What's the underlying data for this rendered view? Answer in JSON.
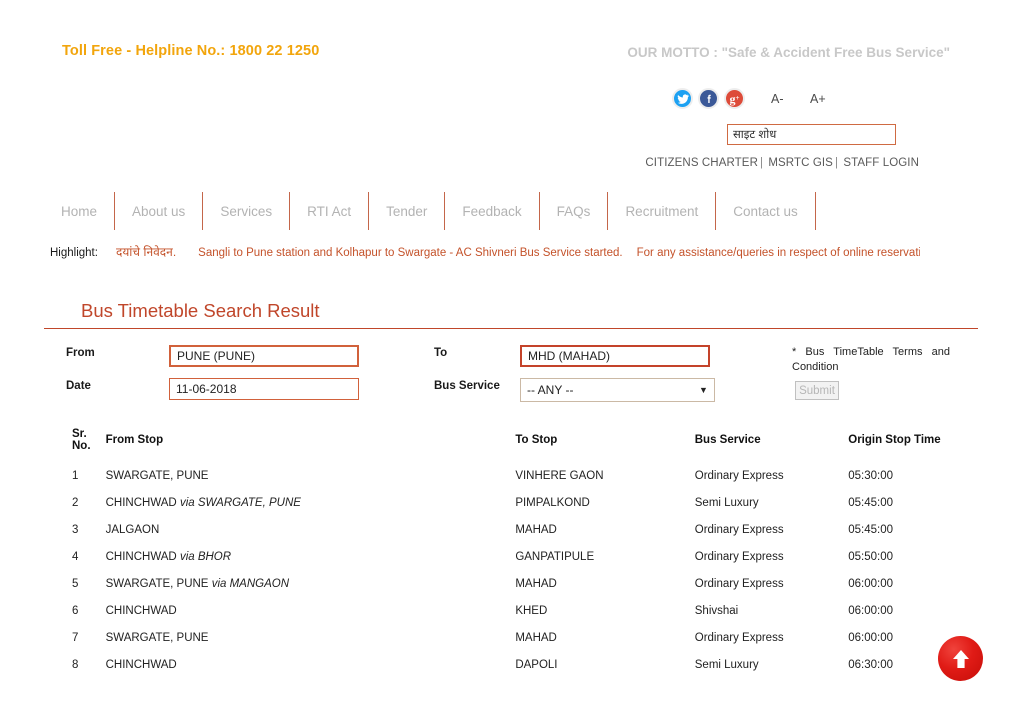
{
  "header": {
    "toll_free": "Toll Free - Helpline No.: 1800 22 1250",
    "motto": "OUR MOTTO : \"Safe & Accident Free Bus Service\"",
    "font_decrease": "A-",
    "font_increase": "A+",
    "social": [
      {
        "name": "twitter-icon",
        "label": "t",
        "color": "#1da1f2"
      },
      {
        "name": "facebook-icon",
        "label": "f",
        "color": "#3b5998"
      },
      {
        "name": "googleplus-icon",
        "label": "g+",
        "color": "#dd4b39"
      }
    ],
    "search": {
      "placeholder": "साइट शोध",
      "value": ""
    },
    "quicklinks": [
      {
        "label": "CITIZENS CHARTER"
      },
      {
        "label": "MSRTC GIS"
      },
      {
        "label": "STAFF LOGIN"
      }
    ],
    "quicklink_separator": "|"
  },
  "nav": {
    "items": [
      {
        "label": "Home",
        "key": "home"
      },
      {
        "label": "About us",
        "key": "about-us"
      },
      {
        "label": "Services",
        "key": "services"
      },
      {
        "label": "RTI Act",
        "key": "rti-act"
      },
      {
        "label": "Tender",
        "key": "tender"
      },
      {
        "label": "Feedback",
        "key": "feedback"
      },
      {
        "label": "FAQs",
        "key": "faqs"
      },
      {
        "label": "Recruitment",
        "key": "recruitment"
      },
      {
        "label": "Contact us",
        "key": "contact-us"
      }
    ]
  },
  "highlight": {
    "label": "Highlight:",
    "marathi": "दयांचे निवेदन.",
    "item1": "Sangli to Pune station and Kolhapur to Swargate - AC Shivneri Bus Service started.",
    "item2": "For any assistance/queries in respect of online reservation"
  },
  "main": {
    "title": "Bus Timetable Search Result",
    "form": {
      "from_label": "From",
      "from_value": "PUNE (PUNE)",
      "date_label": "Date",
      "date_value": "11-06-2018",
      "to_label": "To",
      "to_value": "MHD (MAHAD)",
      "bus_service_label": "Bus Service",
      "bus_service_value": "-- ANY --",
      "bus_service_options": [
        "-- ANY --"
      ],
      "terms_note": "*   Bus   TimeTable   Terms   and Condition",
      "submit_label": "Submit"
    },
    "table": {
      "columns": [
        "Sr. No.",
        "From Stop",
        "To Stop",
        "Bus Service",
        "Origin Stop Time"
      ],
      "rows": [
        {
          "sr": "1",
          "from": "SWARGATE, PUNE",
          "via": "",
          "to": "VINHERE GAON",
          "service": "Ordinary Express",
          "time": "05:30:00"
        },
        {
          "sr": "2",
          "from": "CHINCHWAD",
          "via": "SWARGATE, PUNE",
          "to": "PIMPALKOND",
          "service": "Semi Luxury",
          "time": "05:45:00"
        },
        {
          "sr": "3",
          "from": "JALGAON",
          "via": "",
          "to": "MAHAD",
          "service": "Ordinary Express",
          "time": "05:45:00"
        },
        {
          "sr": "4",
          "from": "CHINCHWAD",
          "via": "BHOR",
          "to": "GANPATIPULE",
          "service": "Ordinary Express",
          "time": "05:50:00"
        },
        {
          "sr": "5",
          "from": "SWARGATE, PUNE",
          "via": "MANGAON",
          "to": "MAHAD",
          "service": "Ordinary Express",
          "time": "06:00:00"
        },
        {
          "sr": "6",
          "from": "CHINCHWAD",
          "via": "",
          "to": "KHED",
          "service": "Shivshai",
          "time": "06:00:00"
        },
        {
          "sr": "7",
          "from": "SWARGATE, PUNE",
          "via": "",
          "to": "MAHAD",
          "service": "Ordinary Express",
          "time": "06:00:00"
        },
        {
          "sr": "8",
          "from": "CHINCHWAD",
          "via": "",
          "to": "DAPOLI",
          "service": "Semi Luxury",
          "time": "06:30:00"
        }
      ],
      "via_word": "via"
    }
  },
  "scroll_top": {
    "name": "scroll-to-top-button",
    "color": "#e01b16"
  },
  "colors": {
    "accent_orange": "#f2a50c",
    "accent_red": "#c0462a",
    "nav_divider": "#c4664a",
    "highlight_text": "#c4522a"
  }
}
